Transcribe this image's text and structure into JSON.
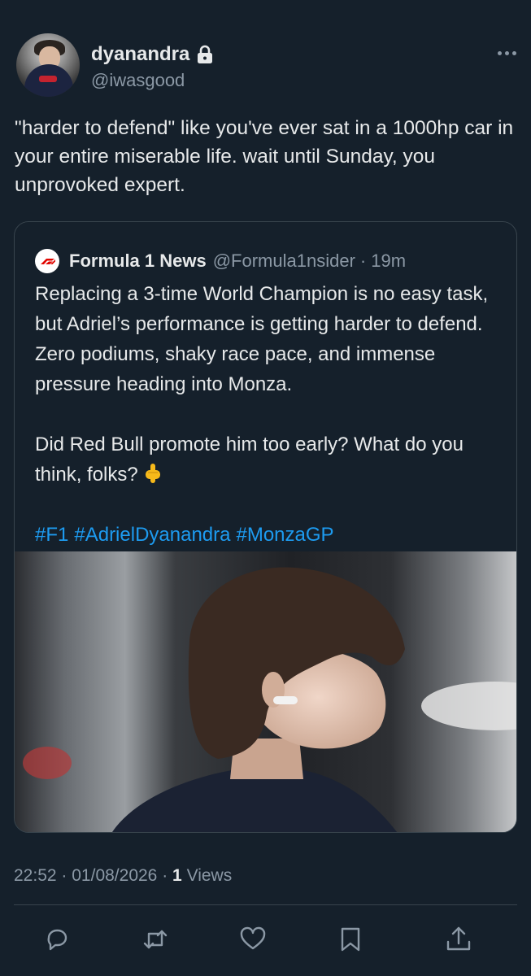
{
  "author": {
    "display_name": "dyanandra",
    "handle": "@iwasgood",
    "protected_icon": "lock-icon"
  },
  "tweet": {
    "text": "\"harder to defend\" like you've ever sat in a 1000hp car in your entire miserable life. wait until Sunday, you unprovoked expert."
  },
  "quoted": {
    "name": "Formula 1 News",
    "handle": "@Formula1nsider",
    "separator": "·",
    "time": "19m",
    "paragraph1": "Replacing a 3-time World Champion is no easy task, but Adriel’s performance is getting harder to defend. Zero podiums, shaky race pace, and immense pressure heading into Monza.",
    "paragraph2": "Did Red Bull promote him too early? What do you think, folks?",
    "paragraph2_emoji": "backhand-index-pointing-down-icon",
    "hashtags": [
      "#F1",
      "#AdrielDyanandra",
      "#MonzaGP"
    ]
  },
  "meta": {
    "time": "22:52",
    "separator": "·",
    "date": "01/08/2026",
    "views_count": "1",
    "views_label": "Views"
  },
  "actions": [
    "reply-icon",
    "retweet-icon",
    "like-icon",
    "bookmark-icon",
    "share-icon"
  ],
  "colors": {
    "background": "#15202b",
    "text": "#e7e9ea",
    "secondary": "#8b98a5",
    "link": "#1d9bf0",
    "border": "#38444d"
  }
}
